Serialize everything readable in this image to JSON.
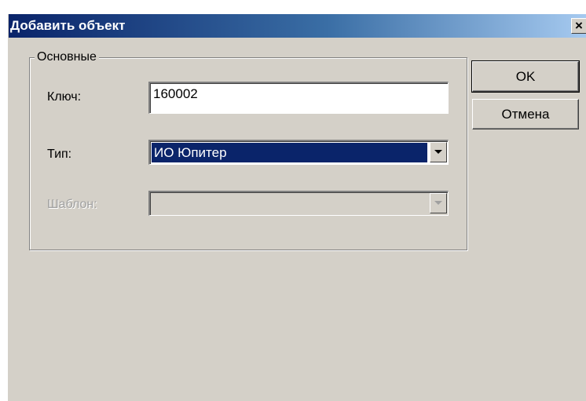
{
  "dialog": {
    "title": "Добавить объект",
    "close_symbol": "×"
  },
  "group": {
    "legend": "Основные"
  },
  "fields": {
    "key_label": "Ключ:",
    "key_value": "160002",
    "type_label": "Тип:",
    "type_value": "ИО Юпитер",
    "template_label": "Шаблон:",
    "template_value": ""
  },
  "buttons": {
    "ok_label": "OK",
    "cancel_label": "Отмена"
  },
  "icons": {
    "close": "close-icon",
    "dropdown": "chevron-down-icon"
  },
  "colors": {
    "title_start": "#0a246a",
    "title_end": "#a6caf0",
    "selection": "#0a246a",
    "face": "#d4d0c8"
  }
}
